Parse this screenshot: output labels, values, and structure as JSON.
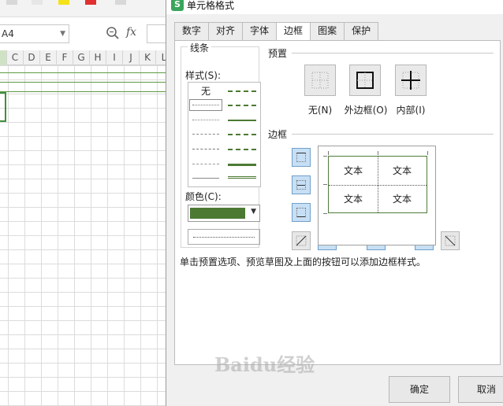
{
  "sheet": {
    "namebox_value": "A4",
    "fx_label": "fx",
    "columns": [
      "C",
      "D",
      "E",
      "F",
      "G",
      "H",
      "I",
      "J",
      "K",
      "L"
    ]
  },
  "dialog": {
    "title": "单元格格式",
    "tabs": [
      {
        "label": "数字",
        "active": false
      },
      {
        "label": "对齐",
        "active": false
      },
      {
        "label": "字体",
        "active": false
      },
      {
        "label": "边框",
        "active": true
      },
      {
        "label": "图案",
        "active": false
      },
      {
        "label": "保护",
        "active": false
      }
    ],
    "line_group": {
      "title": "线条",
      "style_label": "样式(S):",
      "style_none": "无",
      "color_label": "颜色(C):",
      "color_value": "#4c7a33"
    },
    "presets": {
      "title": "预置",
      "items": [
        {
          "label": "无(N)",
          "icon": "border-none-icon"
        },
        {
          "label": "外边框(O)",
          "icon": "border-outline-icon"
        },
        {
          "label": "内部(I)",
          "icon": "border-inside-icon"
        }
      ]
    },
    "border_section": {
      "title": "边框",
      "preview_cells": [
        "文本",
        "文本",
        "文本",
        "文本"
      ]
    },
    "hint": "单击预置选项、预览草图及上面的按钮可以添加边框样式。",
    "buttons": {
      "ok": "确定",
      "cancel": "取消"
    }
  },
  "watermark": "Baidu经验"
}
